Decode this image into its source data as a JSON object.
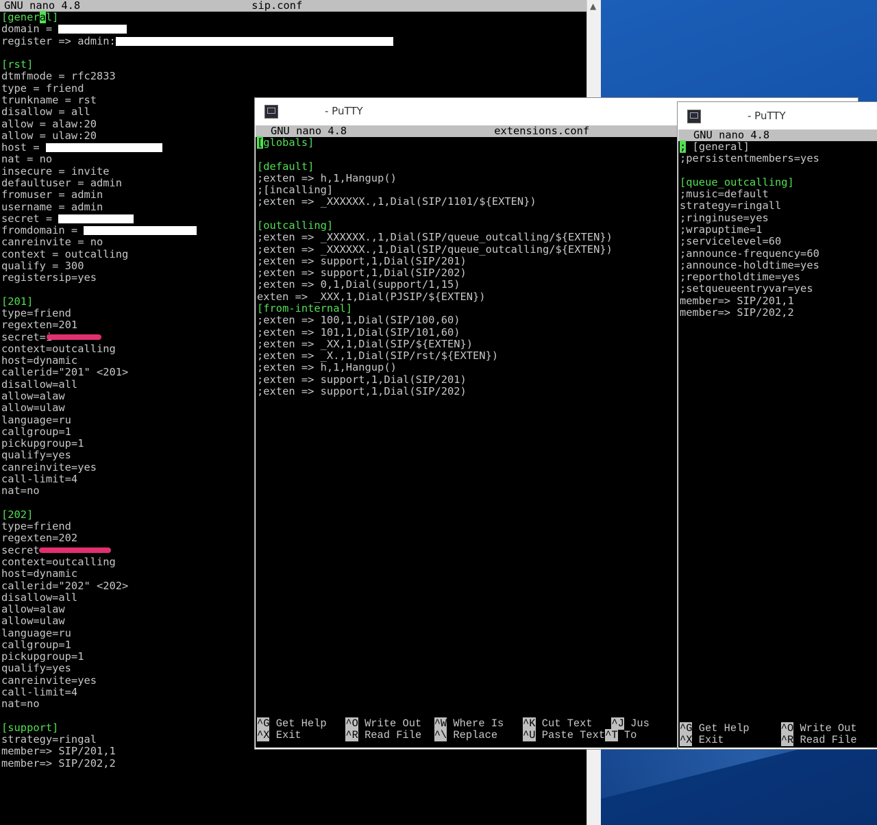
{
  "colors": {
    "terminal_bg": "#000000",
    "terminal_text": "#c8c8c8",
    "section_green": "#52e052",
    "bar_gray": "#c0c0c0",
    "redaction_pink": "#e0306f",
    "desktop_blue": "#0e4aa1"
  },
  "sip_window": {
    "status_app": "GNU nano 4.8",
    "status_file": "sip.conf",
    "scroll_icon": "chevron-up-icon"
  },
  "extensions_window": {
    "title": "- PuTTY",
    "icon": "putty-terminal-icon",
    "status_app": "GNU nano 4.8",
    "status_file": "extensions.conf"
  },
  "queues_window": {
    "title": "- PuTTY",
    "icon": "putty-terminal-icon",
    "status_app": "GNU nano 4.8"
  },
  "sip": {
    "general": {
      "sec_a": "[gener",
      "cursor": "a",
      "sec_b": "l]",
      "domain": "domain = ",
      "register": "register => admin:"
    },
    "rst_section": "[rst]",
    "rst_lines": [
      "dtmfmode = rfc2833",
      "type = friend",
      "trunkname = rst",
      "disallow = all",
      "allow = alaw:20",
      "allow = ulaw:20"
    ],
    "host_line": "host = ",
    "rst_lines2": [
      "nat = no",
      "insecure = invite",
      "defaultuser = admin",
      "fromuser = admin",
      "username = admin"
    ],
    "secret_line": "secret = ",
    "fromdomain_line": "fromdomain = ",
    "rst_lines3": [
      "canreinvite = no",
      "context = outcalling",
      "qualify = 300",
      "registersip=yes"
    ],
    "peer201": {
      "section": "[201]",
      "head": [
        "type=friend",
        "regexten=201"
      ],
      "secret": "secret=i",
      "lines": [
        "context=outcalling",
        "host=dynamic",
        "callerid=\"201\" <201>",
        "disallow=all",
        "allow=alaw",
        "allow=ulaw",
        "language=ru",
        "callgroup=1",
        "pickupgroup=1",
        "qualify=yes",
        "canreinvite=yes",
        "call-limit=4",
        "nat=no"
      ]
    },
    "peer202": {
      "section": "[202]",
      "head": [
        "type=friend",
        "regexten=202"
      ],
      "secret": "secret=",
      "lines": [
        "context=outcalling",
        "host=dynamic",
        "callerid=\"202\" <202>",
        "disallow=all",
        "allow=alaw",
        "allow=ulaw",
        "language=ru",
        "callgroup=1",
        "pickupgroup=1",
        "qualify=yes",
        "canreinvite=yes",
        "call-limit=4",
        "nat=no"
      ]
    },
    "support": {
      "section": "[support]",
      "lines": [
        "strategy=ringal",
        "member=> SIP/201,1",
        "member=> SIP/202,2"
      ]
    }
  },
  "ext": {
    "globals": {
      "cursor": "[",
      "rest": "globals]"
    },
    "default": {
      "section": "[default]",
      "lines": [
        ";exten => h,1,Hangup()",
        ";[incalling]",
        ";exten => _XXXXXX.,1,Dial(SIP/1101/${EXTEN})"
      ]
    },
    "outcalling": {
      "section": "[outcalling]",
      "lines": [
        ";exten => _XXXXXX.,1,Dial(SIP/queue_outcalling/${EXTEN})",
        ";exten => _XXXXXX.,1,Dial(SIP/queue_outcalling/${EXTEN})",
        ";exten => support,1,Dial(SIP/201)",
        ";exten => support,1,Dial(SIP/202)",
        ";exten => 0,1,Dial(support/1,15)",
        "exten => _XXX,1,Dial(PJSIP/${EXTEN})"
      ]
    },
    "from_internal": {
      "section": "[from-internal]",
      "lines": [
        ";exten => 100,1,Dial(SIP/100,60)",
        ";exten => 101,1,Dial(SIP/101,60)",
        ";exten => _XX,1,Dial(SIP/${EXTEN})",
        ";exten => _X.,1,Dial(SIP/rst/${EXTEN})",
        ";exten => h,1,Hangup()",
        ";exten => support,1,Dial(SIP/201)",
        ";exten => support,1,Dial(SIP/202)"
      ]
    },
    "help": {
      "row1": [
        {
          "key": "^G",
          "label": " Get Help  "
        },
        {
          "key": "^O",
          "label": " Write Out "
        },
        {
          "key": "^W",
          "label": " Where Is  "
        },
        {
          "key": "^K",
          "label": " Cut Text  "
        },
        {
          "key": "^J",
          "label": " Jus"
        }
      ],
      "row2": [
        {
          "key": "^X",
          "label": " Exit      "
        },
        {
          "key": "^R",
          "label": " Read File "
        },
        {
          "key": "^\\",
          "label": " Replace   "
        },
        {
          "key": "^U",
          "label": " Paste Text"
        },
        {
          "key": "^T",
          "label": " To"
        }
      ]
    }
  },
  "queues": {
    "general": {
      "cursor": ";",
      "rest": " [general]"
    },
    "persistent": ";persistentmembers=yes",
    "section": "[queue_outcalling]",
    "lines": [
      ";music=default",
      "strategy=ringall",
      ";ringinuse=yes",
      ";wrapuptime=1",
      ";servicelevel=60",
      ";announce-frequency=60",
      ";announce-holdtime=yes",
      ";reportholdtime=yes",
      ";setqueueentryvar=yes",
      "member=> SIP/201,1",
      "member=> SIP/202,2"
    ],
    "help": {
      "row1": [
        {
          "key": "^G",
          "label": " Get Help     "
        },
        {
          "key": "^O",
          "label": " Write Out"
        }
      ],
      "row2": [
        {
          "key": "^X",
          "label": " Exit         "
        },
        {
          "key": "^R",
          "label": " Read File"
        }
      ]
    }
  }
}
